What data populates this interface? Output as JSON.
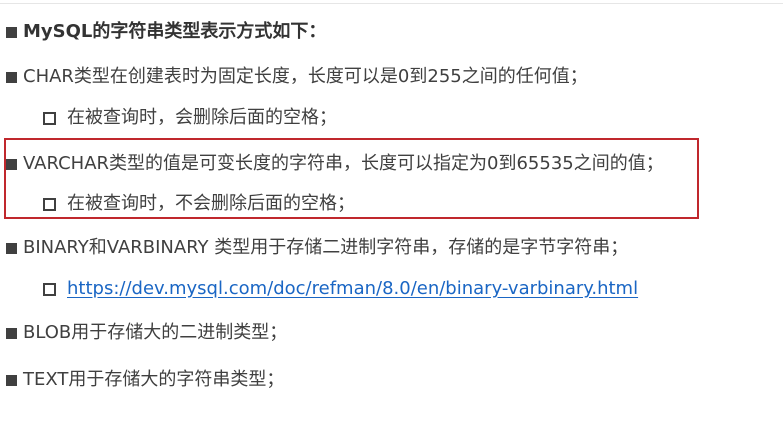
{
  "heading": "MySQL的字符串类型表示方式如下：",
  "items": [
    {
      "text": "CHAR类型在创建表时为固定长度，长度可以是0到255之间的任何值；",
      "sub": "在被查询时，会删除后面的空格；"
    },
    {
      "text": "VARCHAR类型的值是可变长度的字符串，长度可以指定为0到65535之间的值；",
      "sub": "在被查询时，不会删除后面的空格；"
    },
    {
      "text": "BINARY和VARBINARY 类型用于存储二进制字符串，存储的是字节字符串；",
      "sub_link": "https://dev.mysql.com/doc/refman/8.0/en/binary-varbinary.html"
    },
    {
      "text": "BLOB用于存储大的二进制类型；"
    },
    {
      "text": "TEXT用于存储大的字符串类型；"
    }
  ],
  "colors": {
    "text": "#404040",
    "link": "#1a66c4",
    "highlight_border": "#c0282d"
  }
}
